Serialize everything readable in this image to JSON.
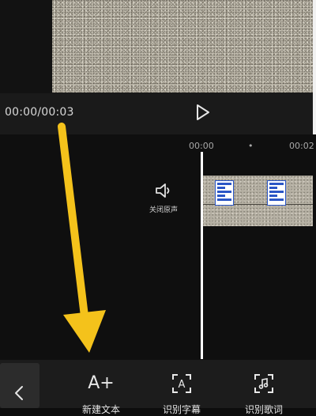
{
  "player": {
    "time_display": "00:00/00:03",
    "play_icon": "play-icon"
  },
  "timeline": {
    "ruler": {
      "start": "00:00",
      "dot": "•",
      "end": "00:02"
    },
    "mute": {
      "label": "关闭原声",
      "icon": "speaker-icon"
    }
  },
  "toolbar": {
    "back_icon": "chevron-left-icon",
    "items": [
      {
        "label": "新建文本",
        "icon": "A+"
      },
      {
        "label": "识别字幕",
        "icon": "text-scan-icon"
      },
      {
        "label": "识别歌词",
        "icon": "music-scan-icon"
      }
    ]
  },
  "colors": {
    "accent_arrow": "#f4c21b",
    "background": "#0d0d0d",
    "playhead": "#ffffff"
  }
}
